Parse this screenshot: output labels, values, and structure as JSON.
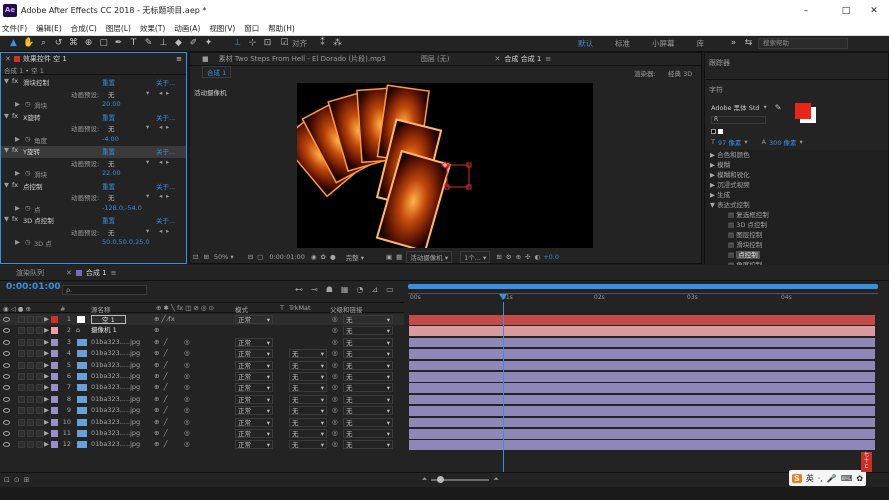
{
  "window": {
    "app_icon": "Ae",
    "title": "Adobe After Effects CC 2018 - 无标题项目.aep *",
    "controls": [
      "–",
      "□",
      "✕"
    ]
  },
  "menu": [
    "文件(F)",
    "编辑(E)",
    "合成(C)",
    "图层(L)",
    "效果(T)",
    "动画(A)",
    "视图(V)",
    "窗口",
    "帮助(H)"
  ],
  "toolbar": {
    "tools": [
      "selection-tool-icon",
      "hand-tool-icon",
      "zoom-tool-icon",
      "rotate-tool-icon",
      "camera-tool-icon",
      "pan-behind-tool-icon",
      "mask-tool-icon",
      "pen-tool-icon",
      "type-tool-icon",
      "brush-tool-icon",
      "clone-stamp-tool-icon",
      "eraser-tool-icon",
      "roto-brush-tool-icon",
      "puppet-tool-icon"
    ],
    "align_label": "对齐",
    "workspaces": [
      "默认",
      "标准",
      "小屏幕",
      "库"
    ],
    "active_workspace": "默认",
    "search_placeholder": "搜索帮助"
  },
  "effect_controls": {
    "tab_label": "效果控件 空 1",
    "subtitle": "合成 1 • 空 1",
    "rows": [
      {
        "type": "fx",
        "label": "滑块控制",
        "reset": "重置",
        "about": "关于..."
      },
      {
        "type": "preset",
        "label": "动画预设:",
        "value": "无"
      },
      {
        "type": "prop",
        "label": "滑块",
        "value": "20.00"
      },
      {
        "type": "fx",
        "label": "X旋转",
        "reset": "重置",
        "about": "关于..."
      },
      {
        "type": "preset",
        "label": "动画预设:",
        "value": "无"
      },
      {
        "type": "prop",
        "label": "角度",
        "value": "-4.00"
      },
      {
        "type": "fx",
        "label": "Y旋转",
        "reset": "重置",
        "about": "关于..."
      },
      {
        "type": "preset",
        "label": "动画预设:",
        "value": "无"
      },
      {
        "type": "prop",
        "label": "滑块",
        "value": "22.00"
      },
      {
        "type": "fx",
        "label": "点控制",
        "reset": "重置",
        "about": "关于..."
      },
      {
        "type": "preset",
        "label": "动画预设:",
        "value": "无"
      },
      {
        "type": "prop",
        "label": "点",
        "value": "-128.0,-54.0"
      },
      {
        "type": "fx",
        "label": "3D 点控制",
        "reset": "重置",
        "about": "关于..."
      },
      {
        "type": "preset",
        "label": "动画预设:",
        "value": "无"
      },
      {
        "type": "prop",
        "label": "3D 点",
        "value": "50.0,50.0,25.0"
      }
    ]
  },
  "project_tabs": {
    "footage": "素材 Two Steps From Hell - El Dorado (片段).mp3",
    "layer": "图层 (无)",
    "comp": "合成 合成 1",
    "comp_subtab": "合成 1",
    "renderer_label": "渲染器:",
    "renderer_value": "经典 3D",
    "camera_label": "活动摄像机"
  },
  "viewer_controls": {
    "zoom": "50%",
    "timecode": "0:00:01:00",
    "resolution": "完整",
    "camera": "活动摄像机",
    "views": "1个...",
    "exposure": "+0.0"
  },
  "right_panel": {
    "tracker_label": "跟踪器",
    "char_label": "字符",
    "font": "Adobe 黑体 Std",
    "font_style": "R",
    "font_size": "97 像素",
    "leading": "300 像素",
    "fx_tree": [
      {
        "label": "合色和颜色",
        "level": 0,
        "arrow": "▶"
      },
      {
        "label": "模糊",
        "level": 0,
        "arrow": "▶"
      },
      {
        "label": "模糊和锐化",
        "level": 0,
        "arrow": "▶"
      },
      {
        "label": "沉浸式视频",
        "level": 0,
        "arrow": "▶"
      },
      {
        "label": "生成",
        "level": 0,
        "arrow": "▶"
      },
      {
        "label": "表达式控制",
        "level": 0,
        "arrow": "▼"
      },
      {
        "label": "复选框控制",
        "level": 1
      },
      {
        "label": "3D 点控制",
        "level": 1
      },
      {
        "label": "图层控制",
        "level": 1
      },
      {
        "label": "滑块控制",
        "level": 1
      },
      {
        "label": "点控制",
        "level": 1,
        "selected": true
      },
      {
        "label": "角度控制",
        "level": 1
      }
    ]
  },
  "timeline": {
    "tab_render": "渲染队列",
    "tab_comp": "合成 1",
    "timecode": "0:00:01:00",
    "search_placeholder": "ρ.",
    "col_name": "源名称",
    "col_mode": "模式",
    "col_t": "T",
    "col_trkmat": "TrkMat",
    "col_parent": "父级和链接",
    "ruler": [
      "00s",
      "01s",
      "02s",
      "03s",
      "04s"
    ],
    "layers": [
      {
        "num": "1",
        "name": "空 1",
        "color": "#d0302c",
        "mode": "正常",
        "trk": "",
        "parent": "无",
        "bar": "#c24b48",
        "type": "null"
      },
      {
        "num": "2",
        "name": "摄像机 1",
        "color": "#e8a0a8",
        "mode": "",
        "trk": "",
        "parent": "无",
        "bar": "#d99aa0",
        "type": "camera"
      },
      {
        "num": "3",
        "name": "01ba323.....jpg",
        "color": "#9a8ec8",
        "mode": "正常",
        "trk": "",
        "parent": "无",
        "bar": "#8f87b8",
        "type": "image"
      },
      {
        "num": "4",
        "name": "01ba323.....jpg",
        "color": "#9a8ec8",
        "mode": "正常",
        "trk": "无",
        "parent": "无",
        "bar": "#8f87b8",
        "type": "image"
      },
      {
        "num": "5",
        "name": "01ba323.....jpg",
        "color": "#9a8ec8",
        "mode": "正常",
        "trk": "无",
        "parent": "无",
        "bar": "#8f87b8",
        "type": "image"
      },
      {
        "num": "6",
        "name": "01ba323.....jpg",
        "color": "#9a8ec8",
        "mode": "正常",
        "trk": "无",
        "parent": "无",
        "bar": "#8f87b8",
        "type": "image"
      },
      {
        "num": "7",
        "name": "01ba323.....jpg",
        "color": "#9a8ec8",
        "mode": "正常",
        "trk": "无",
        "parent": "无",
        "bar": "#8f87b8",
        "type": "image"
      },
      {
        "num": "8",
        "name": "01ba323.....jpg",
        "color": "#9a8ec8",
        "mode": "正常",
        "trk": "无",
        "parent": "无",
        "bar": "#8f87b8",
        "type": "image"
      },
      {
        "num": "9",
        "name": "01ba323.....jpg",
        "color": "#9a8ec8",
        "mode": "正常",
        "trk": "无",
        "parent": "无",
        "bar": "#8f87b8",
        "type": "image"
      },
      {
        "num": "10",
        "name": "01ba323.....jpg",
        "color": "#9a8ec8",
        "mode": "正常",
        "trk": "无",
        "parent": "无",
        "bar": "#8f87b8",
        "type": "image"
      },
      {
        "num": "11",
        "name": "01ba323.....jpg",
        "color": "#9a8ec8",
        "mode": "正常",
        "trk": "无",
        "parent": "无",
        "bar": "#8f87b8",
        "type": "image"
      },
      {
        "num": "12",
        "name": "01ba323.....jpg",
        "color": "#9a8ec8",
        "mode": "正常",
        "trk": "无",
        "parent": "无",
        "bar": "#8f87b8",
        "type": "image"
      }
    ]
  },
  "taskbar": {
    "ime_label": "英",
    "icons": [
      "ime-icon",
      "microphone-icon",
      "keyboard-icon",
      "settings-icon"
    ]
  }
}
